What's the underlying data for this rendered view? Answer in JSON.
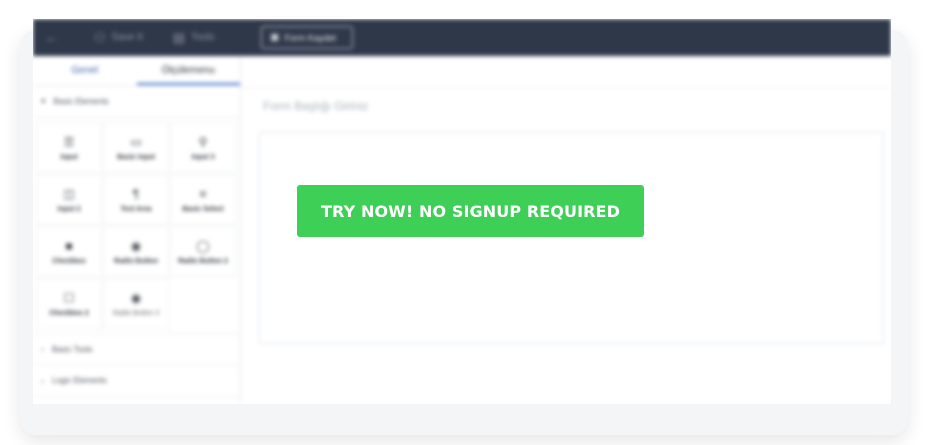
{
  "topbar": {
    "back_glyph": "←",
    "items": [
      {
        "icon": "user-icon",
        "glyph": "⚇",
        "label": "Save It"
      },
      {
        "icon": "tools-icon",
        "glyph": "▤",
        "label": "Tools"
      }
    ],
    "form_button": {
      "icon": "save-icon",
      "glyph": "▣",
      "label": "Form Kaydet"
    }
  },
  "sidebar": {
    "tabs": [
      {
        "label": "Genel",
        "active": false
      },
      {
        "label": "Ölçülemenu",
        "active": true
      }
    ],
    "sections": {
      "basic_elements": "Basic Elements",
      "basic_tools": "Basic Tools",
      "logic_elements": "Logic Elements"
    },
    "elements": [
      {
        "glyph": "☰",
        "label": "Input"
      },
      {
        "glyph": "▭",
        "label": "Basic Input"
      },
      {
        "glyph": "⚲",
        "label": "Input 3"
      },
      {
        "glyph": "◫",
        "label": "Input 2"
      },
      {
        "glyph": "¶",
        "label": "Text Area"
      },
      {
        "glyph": "≡",
        "label": "Basic Select"
      },
      {
        "glyph": "■",
        "label": "Checkbox"
      },
      {
        "glyph": "◉",
        "label": "Radio Button"
      },
      {
        "glyph": "◯",
        "label": "Radio Button 2"
      },
      {
        "glyph": "☐",
        "label": "Checkbox 2"
      },
      {
        "glyph": "◉",
        "label": "Radio Button 3"
      }
    ]
  },
  "main": {
    "title_placeholder": "Form Başlığı Giriniz"
  },
  "cta": {
    "label": "TRY NOW! NO SIGNUP REQUIRED",
    "color": "#3ecf57"
  },
  "colors": {
    "topbar": "#2f3849",
    "accent": "#3a6fc4"
  }
}
